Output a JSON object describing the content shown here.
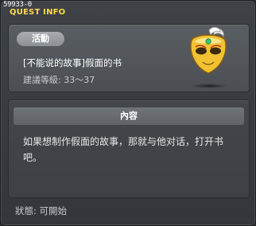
{
  "quest_id": "59933-0",
  "window_title": "QUEST INFO",
  "info": {
    "badge": "活動",
    "quest_name": "[不能说的故事]假面的书",
    "level_text": "建議等級: 33〜37",
    "icon": "golden-mask-icon"
  },
  "content": {
    "header": "內容",
    "description": "如果想制作假面的故事，那就与他对话，打开书吧。"
  },
  "status_text": "狀態: 可開始",
  "colors": {
    "title": "#ffd84a",
    "mask_gold": "#f1c232"
  }
}
